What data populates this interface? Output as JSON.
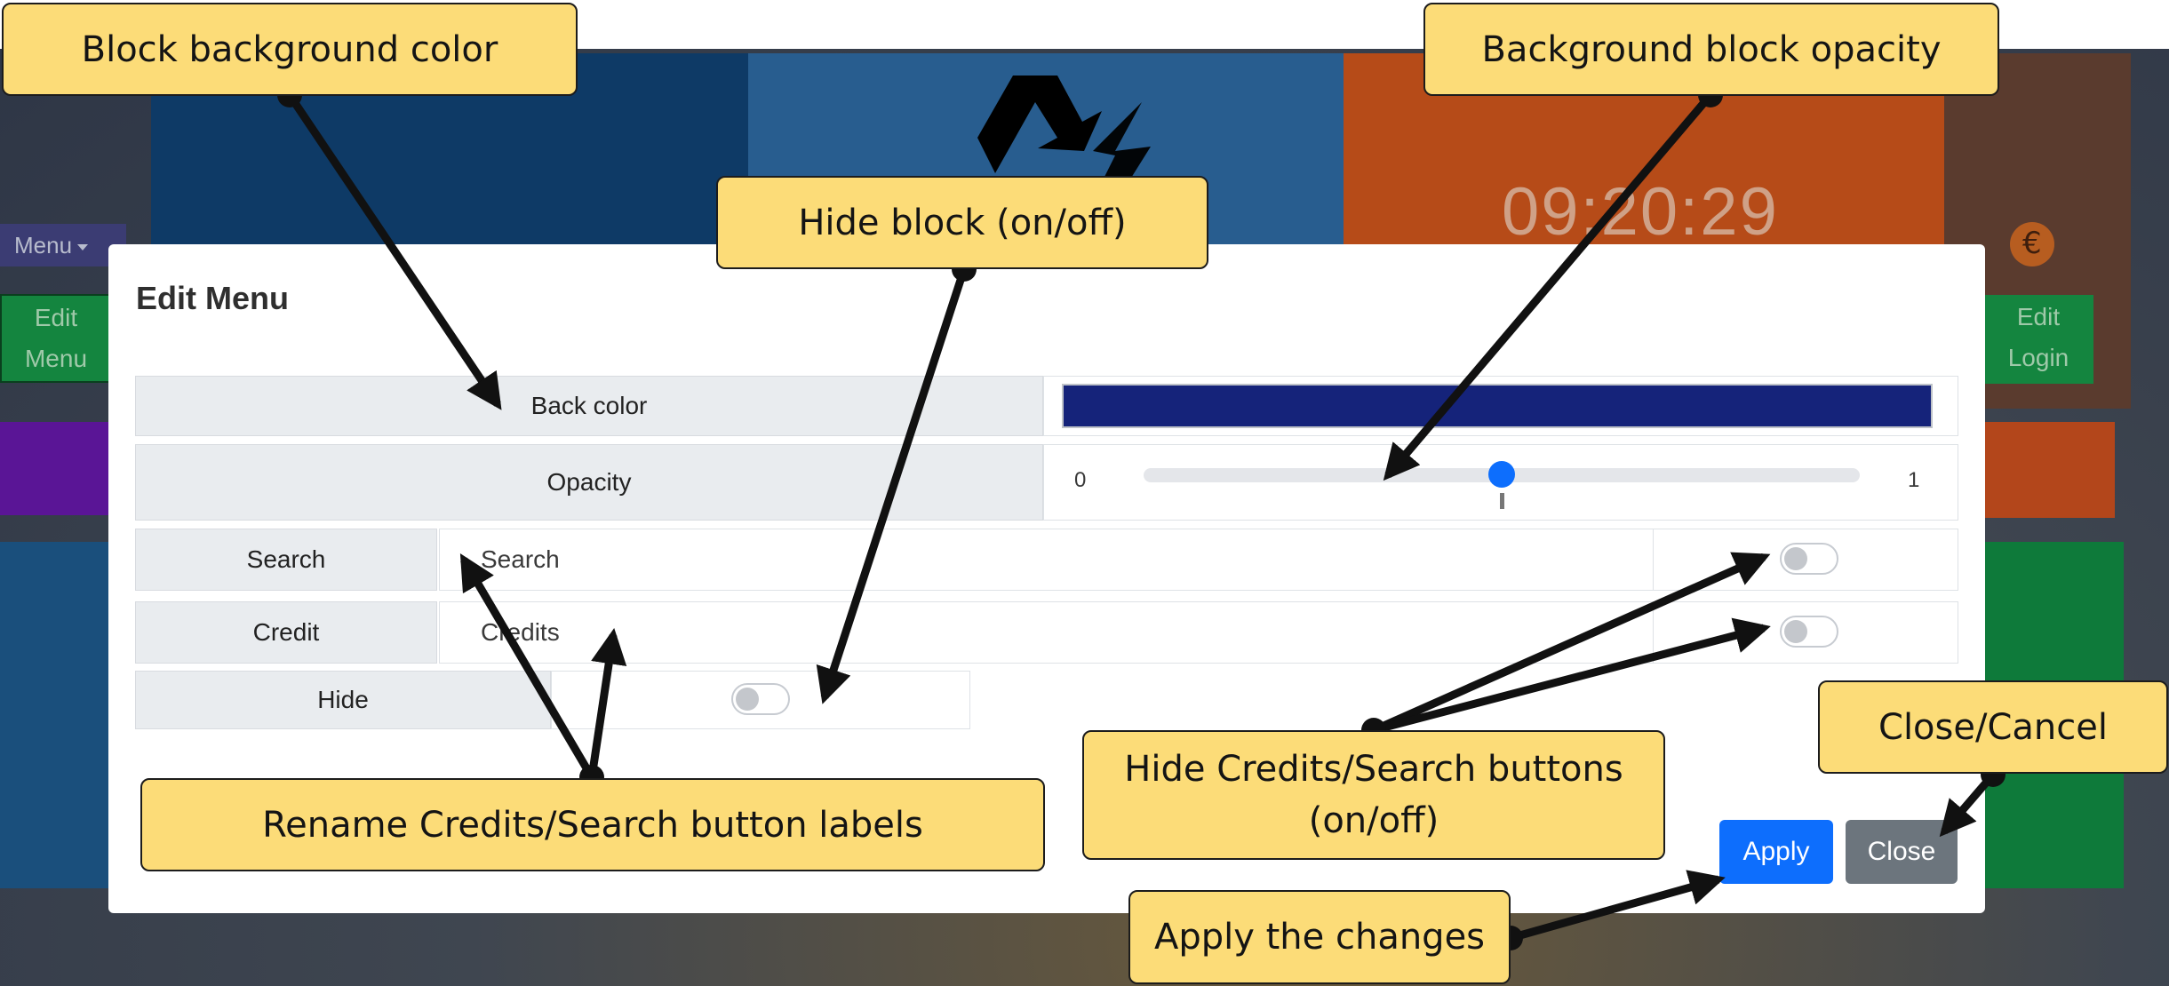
{
  "background": {
    "clock": "09:20:29",
    "menu_button": "Menu",
    "edit_menu_line1": "Edit",
    "edit_menu_line2": "Menu",
    "edit_login_line1": "Edit",
    "edit_login_line2": "Login"
  },
  "modal": {
    "title": "Edit Menu",
    "back_color": {
      "label": "Back color",
      "value": "#15237a"
    },
    "opacity": {
      "label": "Opacity",
      "min_label": "0",
      "max_label": "1",
      "value": 0.5
    },
    "search": {
      "label": "Search",
      "value": "Search",
      "hidden": false
    },
    "credit": {
      "label": "Credit",
      "value": "Credits",
      "hidden": false
    },
    "hide": {
      "label": "Hide",
      "on": false
    },
    "apply_label": "Apply",
    "close_label": "Close"
  },
  "callouts": {
    "block_bg": "Block background color",
    "hide_block": "Hide block (on/off)",
    "opacity": "Background block opacity",
    "rename": "Rename Credits/Search button labels",
    "hide_buttons": "Hide Credits/Search buttons (on/off)",
    "close": "Close/Cancel",
    "apply": "Apply the changes"
  },
  "colors": {
    "accent": "#0d6efd",
    "secondary": "#6c757d",
    "callout": "#fcdc78",
    "back_color_swatch": "#15237a"
  },
  "icons": [
    "recycle-icon",
    "globe-icon",
    "caret-down-icon"
  ]
}
